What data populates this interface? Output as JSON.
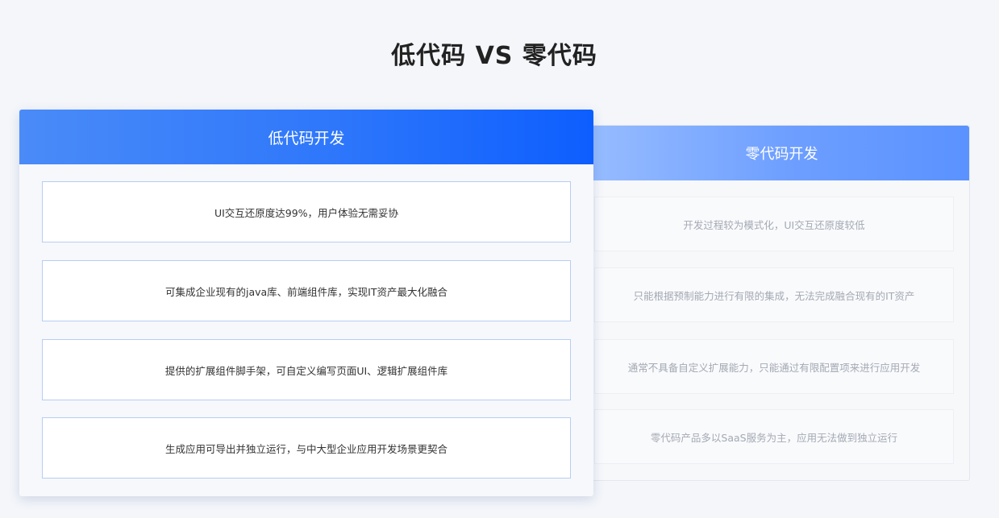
{
  "title": "低代码 VS 零代码",
  "low_code": {
    "header": "低代码开发",
    "items": [
      "UI交互还原度达99%，用户体验无需妥协",
      "可集成企业现有的java库、前端组件库，实现IT资产最大化融合",
      "提供的扩展组件脚手架，可自定义编写页面UI、逻辑扩展组件库",
      "生成应用可导出并独立运行，与中大型企业应用开发场景更契合"
    ]
  },
  "zero_code": {
    "header": "零代码开发",
    "items": [
      "开发过程较为模式化，UI交互还原度较低",
      "只能根据预制能力进行有限的集成，无法完成融合现有的IT资产",
      "通常不具备自定义扩展能力，只能通过有限配置项来进行应用开发",
      "零代码产品多以SaaS服务为主，应用无法做到独立运行"
    ]
  },
  "colors": {
    "low_code_header": "#1e6cfc",
    "zero_code_header": "#6e9fff",
    "item_border": "#b7cdf3",
    "background": "#f4f6fa"
  }
}
